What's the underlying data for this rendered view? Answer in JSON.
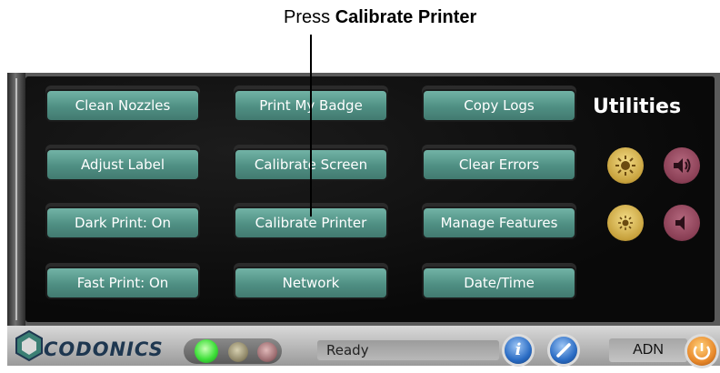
{
  "callout": {
    "prefix": "Press ",
    "target": "Calibrate Printer"
  },
  "screen_title": "Utilities",
  "buttons": {
    "clean_nozzles": "Clean Nozzles",
    "print_my_badge": "Print My Badge",
    "copy_logs": "Copy Logs",
    "adjust_label": "Adjust Label",
    "calibrate_screen": "Calibrate Screen",
    "clear_errors": "Clear Errors",
    "dark_print": "Dark Print: On",
    "calibrate_printer": "Calibrate Printer",
    "manage_features": "Manage Features",
    "fast_print": "Fast Print: On",
    "network": "Network",
    "date_time": "Date/Time"
  },
  "controls": {
    "brightness_up_icon": "sun-large-icon",
    "volume_up_icon": "speaker-loud-icon",
    "brightness_down_icon": "sun-small-icon",
    "volume_down_icon": "speaker-soft-icon"
  },
  "statusbar": {
    "brand": "CODONICS",
    "status_text": "Ready",
    "info_label": "i",
    "user": "ADN"
  },
  "colors": {
    "button_teal": "#5a9c90",
    "brightness_gold": "#d4b24a",
    "volume_mauve": "#8a3f55",
    "led_green": "#3fe03a"
  }
}
